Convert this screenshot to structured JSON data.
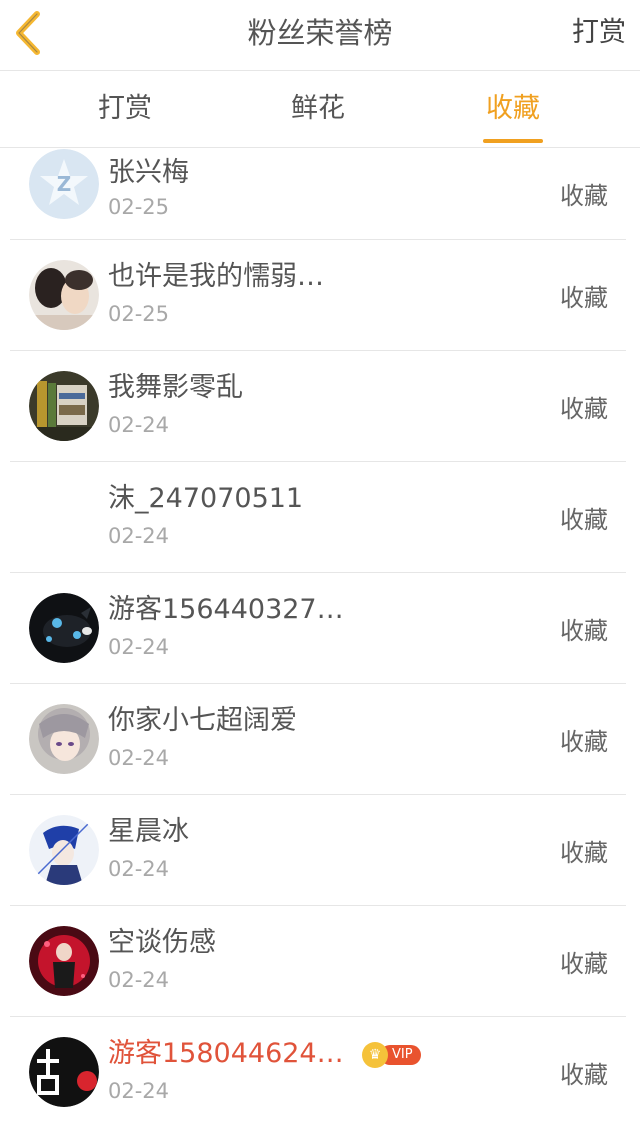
{
  "header": {
    "title": "粉丝荣誉榜",
    "right_link": "打赏"
  },
  "tabs": [
    {
      "label": "打赏",
      "active": false
    },
    {
      "label": "鲜花",
      "active": false
    },
    {
      "label": "收藏",
      "active": true
    }
  ],
  "colors": {
    "accent": "#f0a020",
    "vip_name": "#e0533a",
    "vip_badge": "#e9532e"
  },
  "rows": [
    {
      "name": "张兴梅",
      "date": "02-25",
      "action": "收藏",
      "avatar": "qq-default-avatar"
    },
    {
      "name": "也许是我的懦弱…",
      "date": "02-25",
      "action": "收藏",
      "avatar": "photo-avatar"
    },
    {
      "name": "我舞影零乱",
      "date": "02-24",
      "action": "收藏",
      "avatar": "books-avatar"
    },
    {
      "name": "沫_247070511",
      "date": "02-24",
      "action": "收藏",
      "avatar": "none"
    },
    {
      "name": "游客156440327…",
      "date": "02-24",
      "action": "收藏",
      "avatar": "dark-creature-avatar"
    },
    {
      "name": "你家小七超阔爱",
      "date": "02-24",
      "action": "收藏",
      "avatar": "anime-girl-avatar"
    },
    {
      "name": "星晨冰",
      "date": "02-24",
      "action": "收藏",
      "avatar": "anime-boy-avatar"
    },
    {
      "name": "空谈伤感",
      "date": "02-24",
      "action": "收藏",
      "avatar": "red-dark-avatar"
    },
    {
      "name": "游客158044624…",
      "date": "02-24",
      "action": "收藏",
      "avatar": "black-calligraphy-avatar",
      "vip": true,
      "vip_label": "VIP"
    }
  ]
}
